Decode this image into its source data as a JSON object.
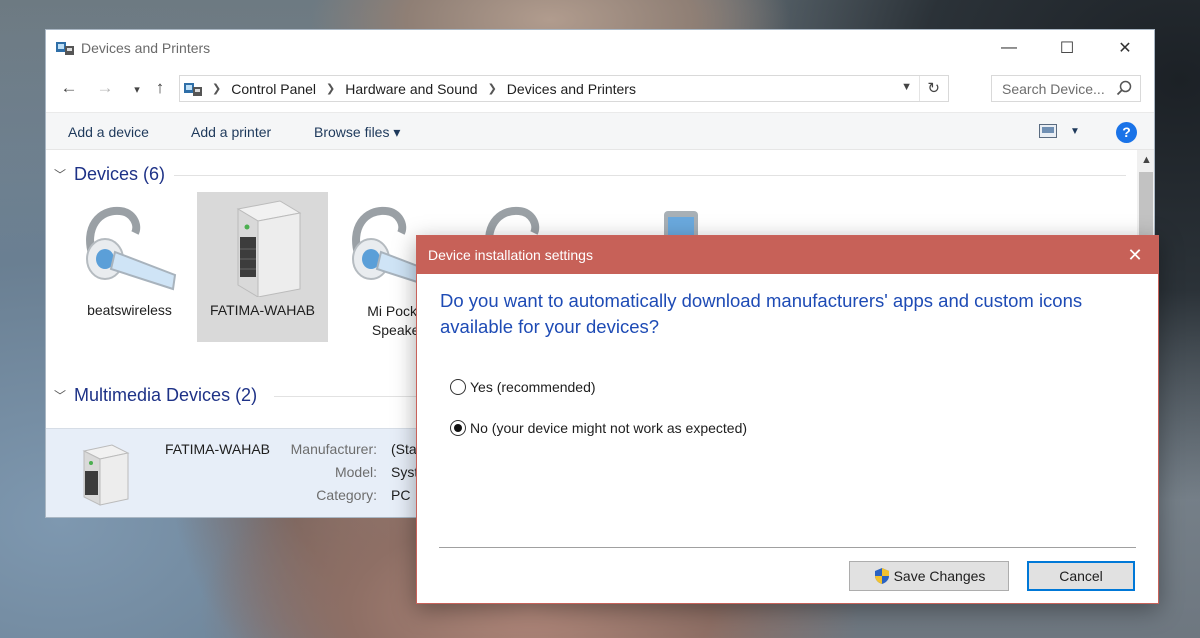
{
  "window": {
    "title": "Devices and Printers",
    "minimize": "—",
    "maximize": "☐",
    "close": "✕"
  },
  "nav": {
    "back": "←",
    "forward": "→",
    "recent": "▾",
    "up": "↑",
    "breadcrumbs": [
      "Control Panel",
      "Hardware and Sound",
      "Devices and Printers"
    ],
    "refresh": "↻",
    "search_placeholder": "Search Device..."
  },
  "toolbar": {
    "add_device": "Add a device",
    "add_printer": "Add a printer",
    "browse_files": "Browse files ▾"
  },
  "groups": {
    "devices": {
      "label": "Devices (6)",
      "items": [
        "beatswireless",
        "FATIMA-WAHAB",
        "Mi Pocket Speaker"
      ]
    },
    "multimedia": {
      "label": "Multimedia Devices (2)"
    }
  },
  "details": {
    "name": "FATIMA-WAHAB",
    "manufacturer_label": "Manufacturer:",
    "manufacturer_value": "(Sta",
    "model_label": "Model:",
    "model_value": "Syst",
    "category_label": "Category:",
    "category_value": "PC"
  },
  "dialog": {
    "title": "Device installation settings",
    "close": "✕",
    "question": "Do you want to automatically download manufacturers' apps and custom icons available for your devices?",
    "option_yes": "Yes (recommended)",
    "option_no": "No (your device might not work as expected)",
    "selected": "no",
    "save": "Save Changes",
    "cancel": "Cancel"
  },
  "colors": {
    "dialog_title_bg": "#c76158",
    "link_blue": "#1e4bb5",
    "help_blue": "#1a73e8"
  }
}
